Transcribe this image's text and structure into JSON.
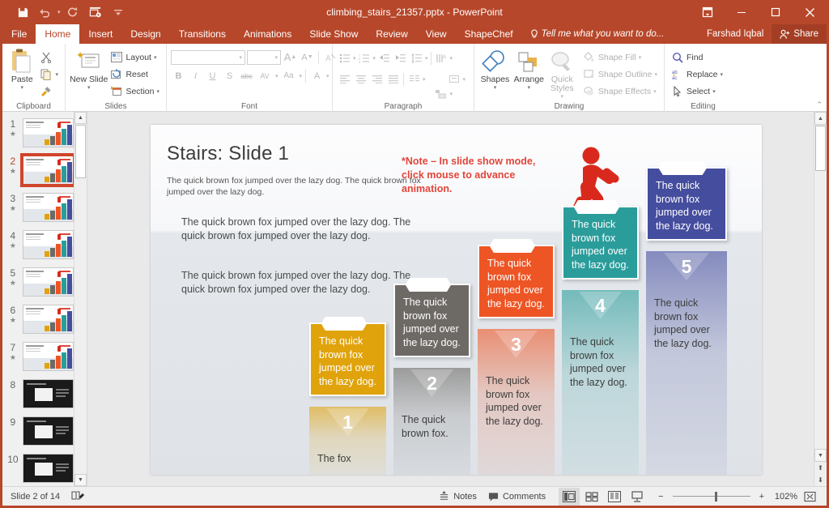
{
  "titlebar": {
    "document_title": "climbing_stairs_21357.pptx - PowerPoint",
    "qat": [
      {
        "name": "save-icon",
        "label": "Save"
      },
      {
        "name": "undo-icon",
        "label": "Undo"
      },
      {
        "name": "redo-icon",
        "label": "Redo"
      },
      {
        "name": "start-slideshow-icon",
        "label": "Start From Beginning"
      },
      {
        "name": "customize-qat-icon",
        "label": "Customize Quick Access Toolbar"
      }
    ],
    "window_controls": [
      {
        "name": "ribbon-display-options-icon",
        "glyph": "⤒"
      },
      {
        "name": "minimize-icon",
        "glyph": "─"
      },
      {
        "name": "maximize-icon",
        "glyph": "☐"
      },
      {
        "name": "close-icon",
        "glyph": "✕"
      }
    ]
  },
  "tabs": {
    "items": [
      "File",
      "Home",
      "Insert",
      "Design",
      "Transitions",
      "Animations",
      "Slide Show",
      "Review",
      "View",
      "ShapeChef"
    ],
    "active": "Home",
    "tell_me": "Tell me what you want to do...",
    "user_name": "Farshad Iqbal",
    "share_label": "Share"
  },
  "ribbon": {
    "groups": [
      {
        "name": "clipboard",
        "label": "Clipboard",
        "paste_label": "Paste",
        "buttons": [
          "Cut",
          "Copy",
          "Format Painter"
        ]
      },
      {
        "name": "slides",
        "label": "Slides",
        "new_slide_label": "New Slide",
        "items": [
          "Layout",
          "Reset",
          "Section"
        ]
      },
      {
        "name": "font",
        "label": "Font",
        "font_name_value": "",
        "font_size_value": "",
        "buttons": [
          "Increase Font Size",
          "Decrease Font Size",
          "Clear All Formatting",
          "Bold",
          "Italic",
          "Underline",
          "Text Shadow",
          "Strikethrough",
          "Character Spacing",
          "Change Case",
          "Font Color"
        ],
        "glyphs": {
          "bold": "B",
          "italic": "I",
          "underline": "U",
          "shadow": "S",
          "strike": "abc",
          "spacing": "AV",
          "case": "Aa",
          "color": "A"
        }
      },
      {
        "name": "paragraph",
        "label": "Paragraph",
        "buttons": [
          "Bullets",
          "Numbering",
          "Decrease Indent",
          "Increase Indent",
          "Line Spacing",
          "Text Direction",
          "Align Text",
          "Convert to SmartArt",
          "Align Left",
          "Center",
          "Align Right",
          "Justify",
          "Columns"
        ]
      },
      {
        "name": "drawing",
        "label": "Drawing",
        "shapes_label": "Shapes",
        "arrange_label": "Arrange",
        "quick_styles_label": "Quick Styles",
        "items": [
          "Shape Fill",
          "Shape Outline",
          "Shape Effects"
        ]
      },
      {
        "name": "editing",
        "label": "Editing",
        "items": [
          "Find",
          "Replace",
          "Select"
        ]
      }
    ],
    "collapse_label": "Collapse the Ribbon"
  },
  "thumbnails": {
    "selected_index": 2,
    "slides": [
      {
        "number": "1",
        "starred": true,
        "dark": false
      },
      {
        "number": "2",
        "starred": true,
        "dark": false
      },
      {
        "number": "3",
        "starred": true,
        "dark": false
      },
      {
        "number": "4",
        "starred": true,
        "dark": false
      },
      {
        "number": "5",
        "starred": true,
        "dark": false
      },
      {
        "number": "6",
        "starred": true,
        "dark": false
      },
      {
        "number": "7",
        "starred": true,
        "dark": false
      },
      {
        "number": "8",
        "starred": false,
        "dark": true
      },
      {
        "number": "9",
        "starred": false,
        "dark": true
      },
      {
        "number": "10",
        "starred": false,
        "dark": true
      }
    ]
  },
  "slide": {
    "title": "Stairs: Slide 1",
    "subtitle": "The quick brown fox jumped over the lazy dog. The quick brown fox jumped over the lazy dog.",
    "paragraph1": "The quick brown fox jumped over the lazy dog. The quick brown fox jumped over the lazy dog.",
    "paragraph2": "The quick brown fox jumped over the lazy dog. The quick brown fox jumped over the lazy dog.",
    "note": "*Note – In slide show mode, click mouse to advance animation.",
    "runner_color": "#d9291c",
    "steps": [
      {
        "number": "1",
        "color": "#e0a30c",
        "card_text": "The quick brown fox jumped over the lazy dog.",
        "desc": "The fox"
      },
      {
        "number": "2",
        "color": "#6d6a66",
        "card_text": "The quick brown fox jumped over the lazy dog.",
        "desc": "The quick brown fox."
      },
      {
        "number": "3",
        "color": "#ee5524",
        "card_text": "The quick brown fox jumped over the lazy dog.",
        "desc": "The quick brown fox jumped over the lazy dog."
      },
      {
        "number": "4",
        "color": "#2a9d9b",
        "card_text": "The quick brown fox jumped over the lazy dog.",
        "desc": "The quick brown fox jumped over the lazy dog."
      },
      {
        "number": "5",
        "color": "#454d9e",
        "card_text": "The quick brown fox jumped over the lazy dog.",
        "desc": "The quick brown fox jumped over the lazy dog."
      }
    ]
  },
  "statusbar": {
    "slide_counter": "Slide 2 of 14",
    "accessibility_icon": "notes-page-icon",
    "notes_label": "Notes",
    "comments_label": "Comments",
    "views": [
      {
        "name": "normal-view",
        "active": true
      },
      {
        "name": "slide-sorter-view",
        "active": false
      },
      {
        "name": "reading-view",
        "active": false
      },
      {
        "name": "slide-show-view",
        "active": false
      }
    ],
    "zoom_out_label": "−",
    "zoom_in_label": "+",
    "zoom_percent": "102%",
    "fit_label": "Fit slide to current window"
  },
  "colors": {
    "brand": "#b7472a",
    "accent_red": "#e2453a"
  }
}
